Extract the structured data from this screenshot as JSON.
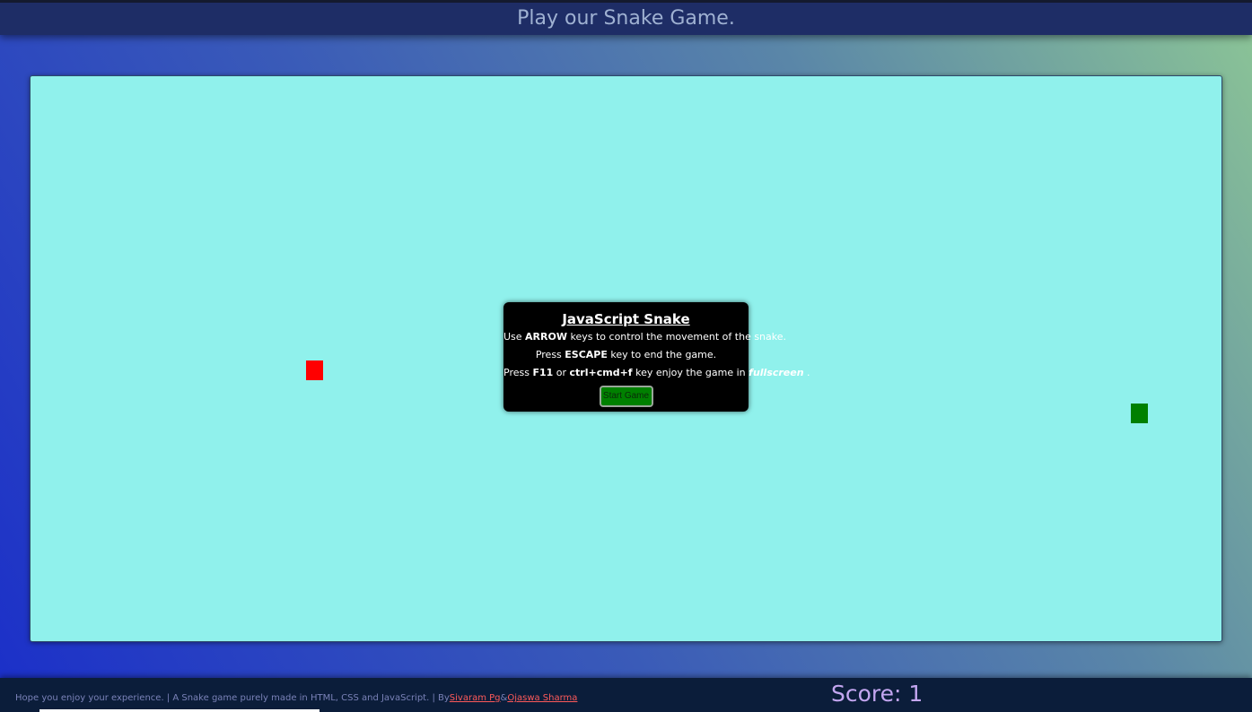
{
  "header": {
    "title": "Play our Snake Game."
  },
  "board": {
    "background": "#90f1ec",
    "food_color": "#ff0000",
    "snake_color": "#008000"
  },
  "modal": {
    "title": "JavaScript Snake",
    "line1": {
      "pre": "Use ",
      "key": "ARROW",
      "post": " keys to control the movement of the snake."
    },
    "line2": {
      "pre": "Press ",
      "key": "ESCAPE",
      "post": " key to end the game."
    },
    "line3": {
      "pre": "Press ",
      "key1": "F11",
      "mid1": " or ",
      "key2": "ctrl+cmd+f",
      "mid2": " key enjoy the game in ",
      "em": "fullscreen",
      "post": " ."
    },
    "start_button": "Start Game"
  },
  "footer": {
    "credits_text": "Hope you enjoy your experience. | A Snake game purely made in HTML, CSS and JavaScript. | By",
    "author1": "Sivaram Pg",
    "separator": "&",
    "author2": "Ojaswa Sharma",
    "score_label": "Score: ",
    "score_value": "1"
  }
}
